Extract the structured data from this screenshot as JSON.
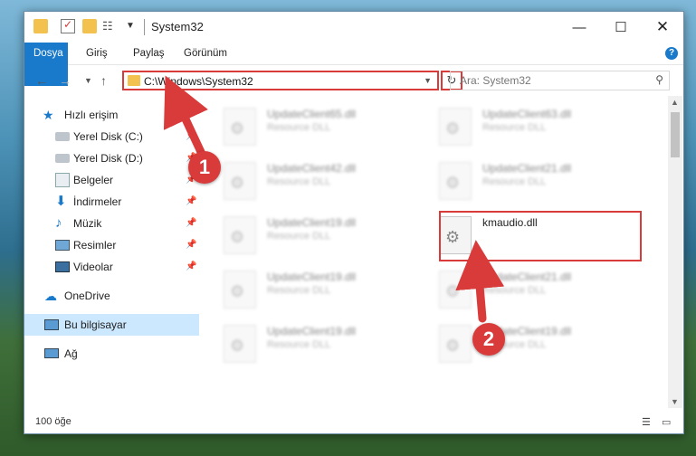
{
  "window": {
    "title": "System32"
  },
  "ribbon": {
    "tabs": [
      "Dosya",
      "Giriş",
      "Paylaş",
      "Görünüm"
    ]
  },
  "address": {
    "path": "C:\\Windows\\System32"
  },
  "search": {
    "placeholder": "Ara: System32"
  },
  "sidebar": {
    "items": [
      {
        "label": "Hızlı erişim",
        "icon": "star-icon"
      },
      {
        "label": "Yerel Disk (C:)",
        "icon": "drive-icon"
      },
      {
        "label": "Yerel Disk (D:)",
        "icon": "drive-icon"
      },
      {
        "label": "Belgeler",
        "icon": "documents-icon"
      },
      {
        "label": "İndirmeler",
        "icon": "download-icon"
      },
      {
        "label": "Müzik",
        "icon": "music-icon"
      },
      {
        "label": "Resimler",
        "icon": "pictures-icon"
      },
      {
        "label": "Videolar",
        "icon": "videos-icon"
      },
      {
        "label": "OneDrive",
        "icon": "cloud-icon"
      },
      {
        "label": "Bu bilgisayar",
        "icon": "computer-icon"
      },
      {
        "label": "Ağ",
        "icon": "network-icon"
      }
    ]
  },
  "files": [
    {
      "name": "UpdateClient65.dll",
      "type": "Resource DLL"
    },
    {
      "name": "UpdateClient63.dll",
      "type": "Resource DLL"
    },
    {
      "name": "UpdateClient42.dll",
      "type": "Resource DLL"
    },
    {
      "name": "UpdateClient21.dll",
      "type": "Resource DLL"
    },
    {
      "name": "UpdateClient19.dll",
      "type": "Resource DLL"
    },
    {
      "name": "kmaudio.dll",
      "type": ""
    },
    {
      "name": "UpdateClient19.dll",
      "type": "Resource DLL"
    },
    {
      "name": "UpdateClient21.dll",
      "type": "Resource DLL"
    },
    {
      "name": "UpdateClient19.dll",
      "type": "Resource DLL"
    },
    {
      "name": "UpdateClient19.dll",
      "type": "Resource DLL"
    }
  ],
  "annotations": {
    "step1": "1",
    "step2": "2",
    "color": "#d93a3a"
  },
  "status": {
    "count": "100 öğe"
  }
}
